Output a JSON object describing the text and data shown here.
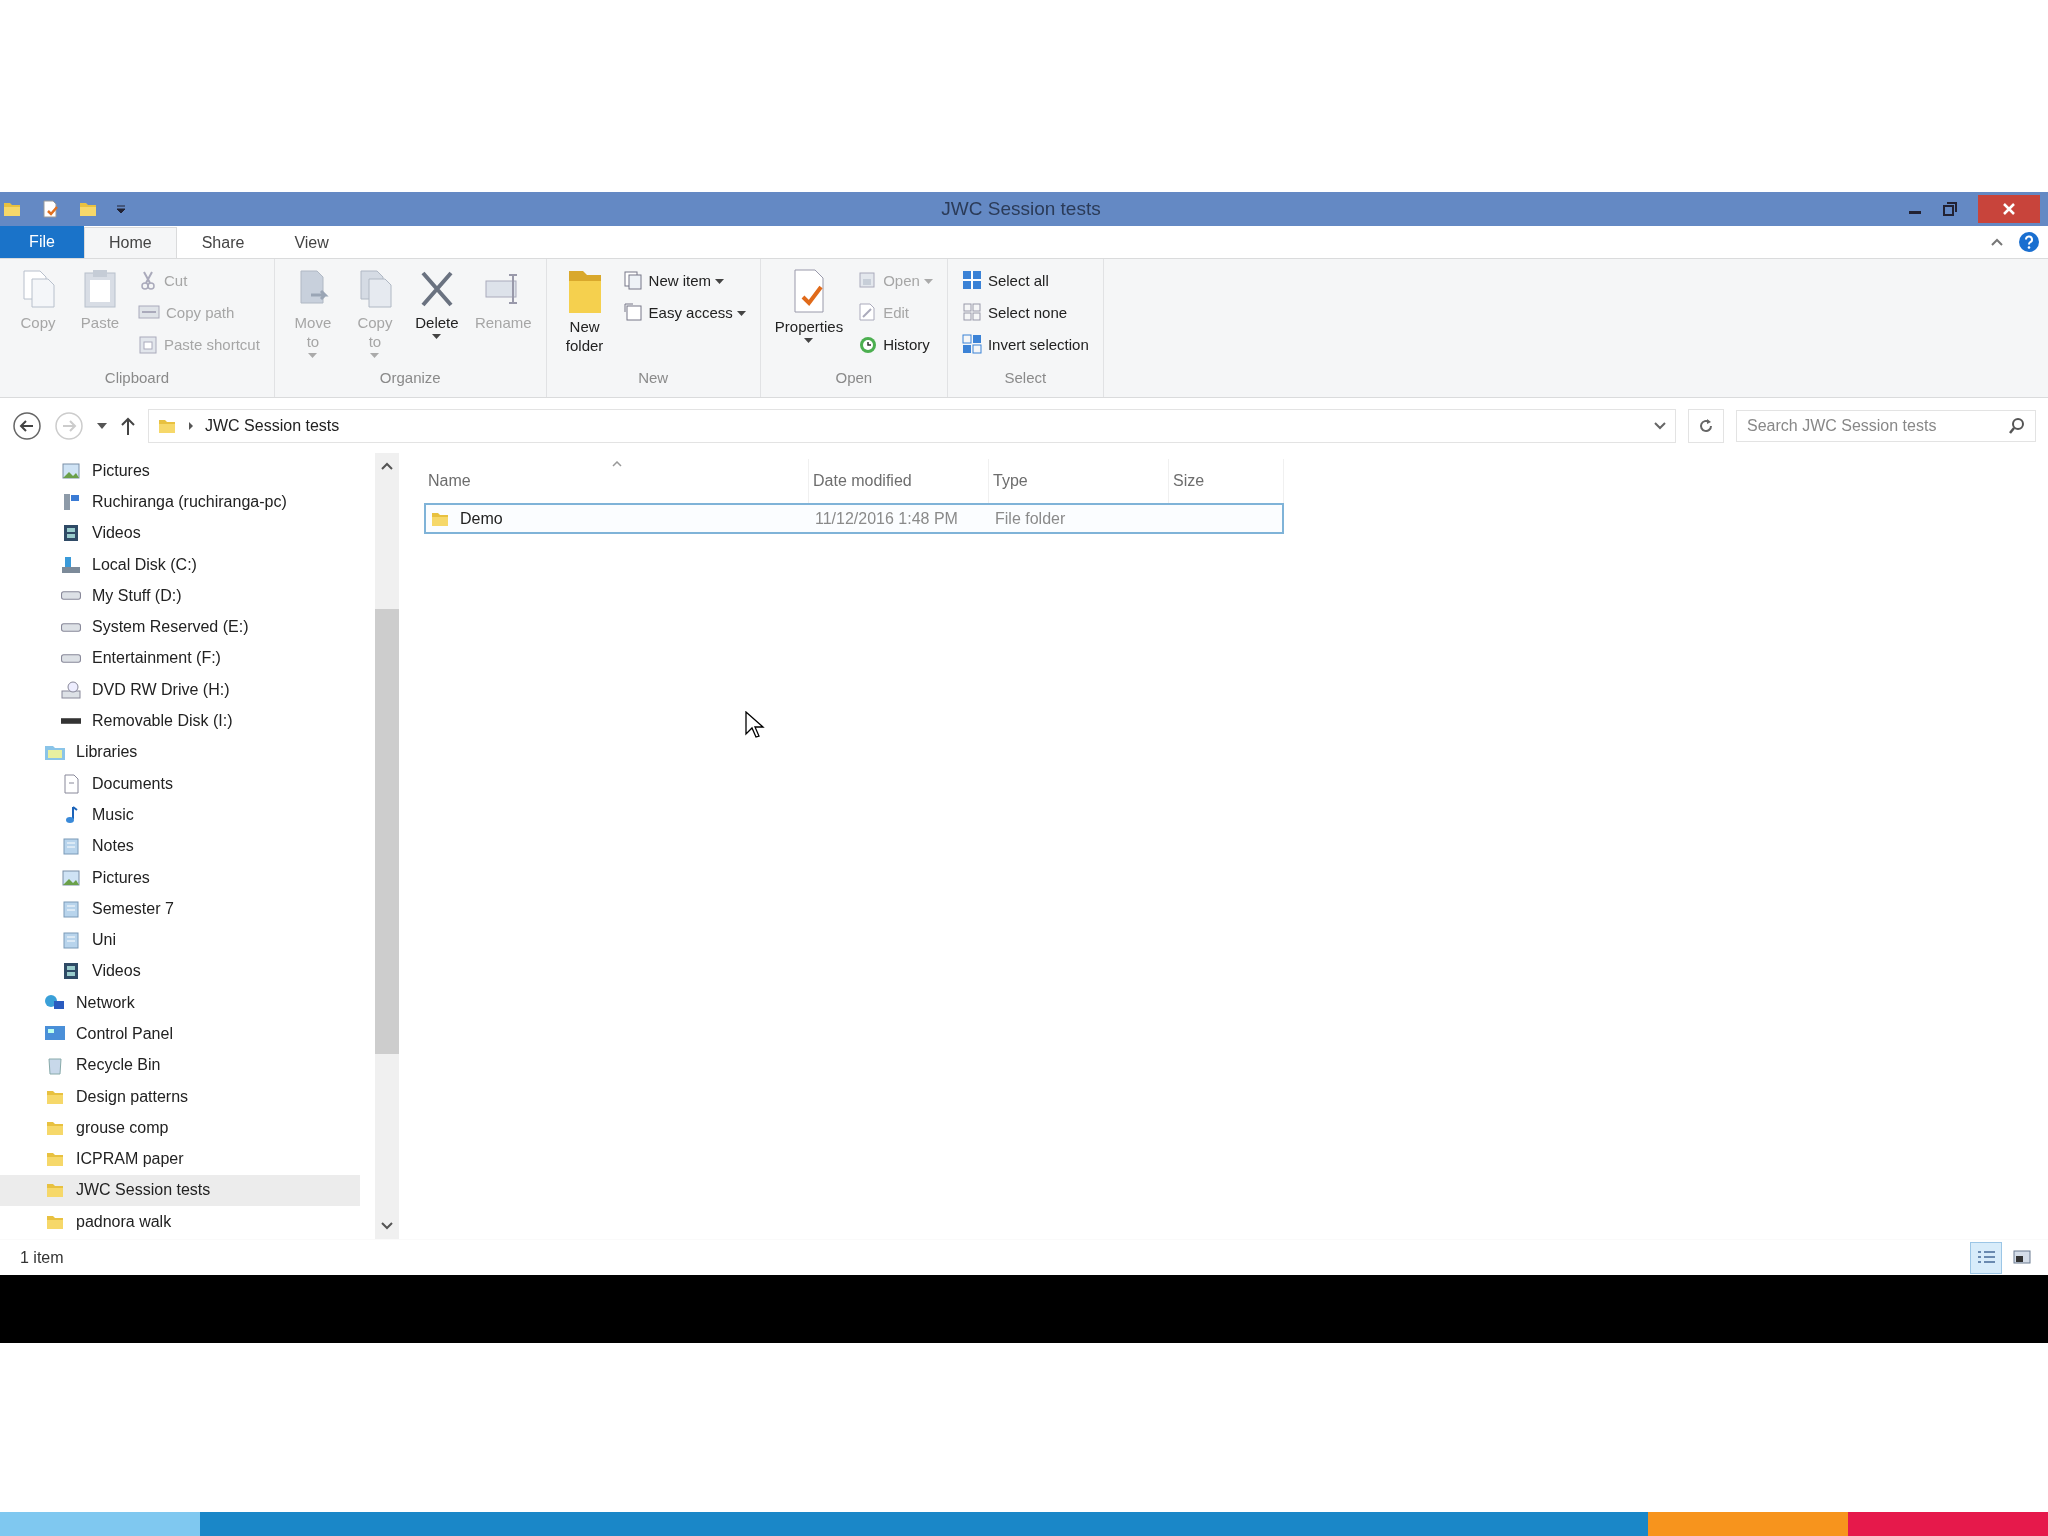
{
  "window": {
    "title": "JWC Session tests"
  },
  "ribbon_tabs": [
    {
      "label": "File",
      "kind": "file",
      "selected": false
    },
    {
      "label": "Home",
      "kind": "tab",
      "selected": true
    },
    {
      "label": "Share",
      "kind": "tab",
      "selected": false
    },
    {
      "label": "View",
      "kind": "tab",
      "selected": false
    }
  ],
  "ribbon": {
    "groups": [
      {
        "label": "Clipboard",
        "buttons": [
          {
            "label": "Copy",
            "kind": "large",
            "disabled": true,
            "dropdown": false
          },
          {
            "label": "Paste",
            "kind": "large",
            "disabled": true,
            "dropdown": false
          },
          {
            "label": "Cut",
            "kind": "small",
            "disabled": true,
            "dropdown": false
          },
          {
            "label": "Copy path",
            "kind": "small",
            "disabled": true,
            "dropdown": false
          },
          {
            "label": "Paste shortcut",
            "kind": "small",
            "disabled": true,
            "dropdown": false
          }
        ]
      },
      {
        "label": "Organize",
        "buttons": [
          {
            "label": "Move to",
            "kind": "large",
            "disabled": true,
            "dropdown": true
          },
          {
            "label": "Copy to",
            "kind": "large",
            "disabled": true,
            "dropdown": true
          },
          {
            "label": "Delete",
            "kind": "large",
            "disabled": false,
            "dropdown": true
          },
          {
            "label": "Rename",
            "kind": "large",
            "disabled": true,
            "dropdown": false
          }
        ]
      },
      {
        "label": "New",
        "buttons": [
          {
            "label": "New folder",
            "kind": "large",
            "disabled": false,
            "dropdown": false
          },
          {
            "label": "New item",
            "kind": "small",
            "disabled": false,
            "dropdown": true
          },
          {
            "label": "Easy access",
            "kind": "small",
            "disabled": false,
            "dropdown": true
          }
        ]
      },
      {
        "label": "Open",
        "buttons": [
          {
            "label": "Properties",
            "kind": "large",
            "disabled": false,
            "dropdown": true
          },
          {
            "label": "Open",
            "kind": "small",
            "disabled": true,
            "dropdown": true
          },
          {
            "label": "Edit",
            "kind": "small",
            "disabled": true,
            "dropdown": false
          },
          {
            "label": "History",
            "kind": "small",
            "disabled": false,
            "dropdown": false
          }
        ]
      },
      {
        "label": "Select",
        "buttons": [
          {
            "label": "Select all",
            "kind": "small",
            "disabled": false,
            "dropdown": false
          },
          {
            "label": "Select none",
            "kind": "small",
            "disabled": false,
            "dropdown": false
          },
          {
            "label": "Invert selection",
            "kind": "small",
            "disabled": false,
            "dropdown": false
          }
        ]
      }
    ]
  },
  "address_bar": {
    "path": [
      "JWC Session tests"
    ],
    "search": {
      "placeholder": "Search JWC Session tests"
    }
  },
  "navigation": {
    "items": [
      {
        "children": [
          {
            "label": "Pictures",
            "selected": false
          },
          {
            "label": "Ruchiranga (ruchiranga-pc)",
            "selected": false
          },
          {
            "label": "Videos",
            "selected": false
          },
          {
            "label": "Local Disk (C:)",
            "selected": false
          },
          {
            "label": "My Stuff (D:)",
            "selected": false
          },
          {
            "label": "System Reserved (E:)",
            "selected": false
          },
          {
            "label": "Entertainment (F:)",
            "selected": false
          },
          {
            "label": "DVD RW Drive (H:)",
            "selected": false
          },
          {
            "label": "Removable Disk (I:)",
            "selected": false
          }
        ]
      },
      {
        "label": "Libraries",
        "selected": false,
        "children": [
          {
            "label": "Documents",
            "selected": false
          },
          {
            "label": "Music",
            "selected": false
          },
          {
            "label": "Notes",
            "selected": false
          },
          {
            "label": "Pictures",
            "selected": false
          },
          {
            "label": "Semester 7",
            "selected": false
          },
          {
            "label": "Uni",
            "selected": false
          },
          {
            "label": "Videos",
            "selected": false
          }
        ]
      },
      {
        "label": "Network",
        "selected": false
      },
      {
        "label": "Control Panel",
        "selected": false
      },
      {
        "label": "Recycle Bin",
        "selected": false
      },
      {
        "label": "Design patterns",
        "selected": false
      },
      {
        "label": "grouse comp",
        "selected": false
      },
      {
        "label": "ICPRAM paper",
        "selected": false
      },
      {
        "label": "JWC Session tests",
        "selected": true
      },
      {
        "label": "padnora walk",
        "selected": false
      }
    ]
  },
  "file_list": {
    "columns": [
      "Name",
      "Date modified",
      "Type",
      "Size"
    ],
    "rows": [
      {
        "name": "Demo",
        "date_modified": "11/12/2016 1:48 PM",
        "type": "File folder",
        "selected": true
      }
    ]
  },
  "status_bar": {
    "text": "1 item",
    "views": [
      {
        "kind": "details",
        "selected": true
      },
      {
        "kind": "large-icons",
        "selected": false
      }
    ]
  }
}
